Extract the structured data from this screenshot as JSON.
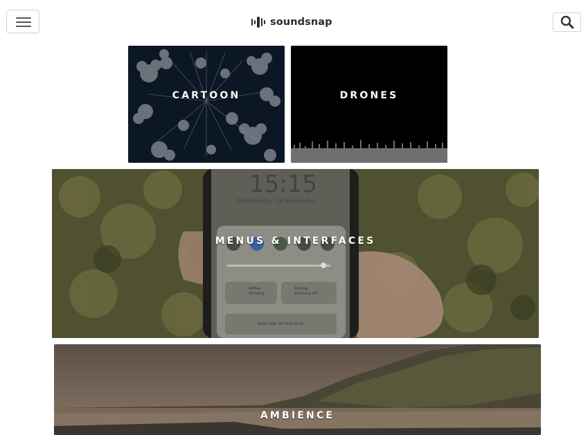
{
  "header": {
    "brand": "soundsnap",
    "menu_icon": "hamburger-icon",
    "logo_icon": "soundwave-logo-icon",
    "search_icon": "search-icon"
  },
  "categories": [
    {
      "label": "CARTOON"
    },
    {
      "label": "DRONES"
    },
    {
      "label": "MENUS & INTERFACES"
    },
    {
      "label": "AMBIENCE"
    }
  ],
  "phone_screen": {
    "time": "15:15",
    "date": "Wednesday 18 November",
    "airplay": "AirPlay",
    "airplay_sub": "Mirroring",
    "airdrop": "AirDrop:",
    "airdrop_sub": "Receiving Off",
    "night_shift": "Night Shift: Off Until 22:00"
  },
  "colors": {
    "cartoon_bg": "#0b1624",
    "drones_bg": "#000000",
    "menus_bg": "#5a5a34",
    "ambience_sky": "#6e5a4a"
  }
}
